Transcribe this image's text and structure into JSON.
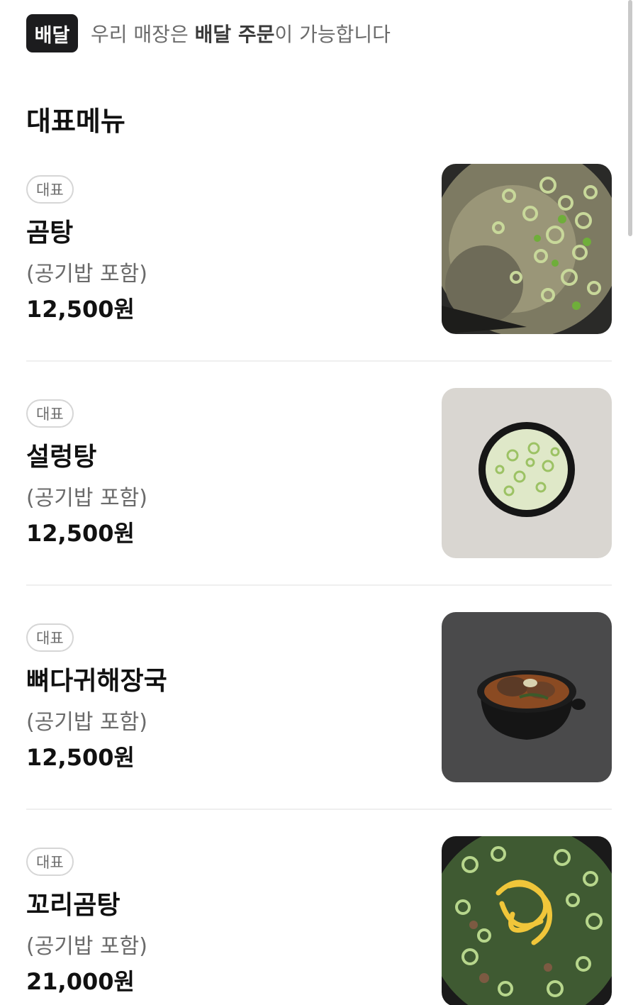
{
  "delivery": {
    "badge": "배달",
    "text_prefix": "우리 매장은 ",
    "text_bold": "배달 주문",
    "text_suffix": "이 가능합니다"
  },
  "section_title": "대표메뉴",
  "menu": [
    {
      "tag": "대표",
      "name": "곰탕",
      "description": "(공기밥 포함)",
      "price": "12,500원"
    },
    {
      "tag": "대표",
      "name": "설렁탕",
      "description": "(공기밥 포함)",
      "price": "12,500원"
    },
    {
      "tag": "대표",
      "name": "뼈다귀해장국",
      "description": "(공기밥 포함)",
      "price": "12,500원"
    },
    {
      "tag": "대표",
      "name": "꼬리곰탕",
      "description": "(공기밥 포함)",
      "price": "21,000원"
    }
  ]
}
